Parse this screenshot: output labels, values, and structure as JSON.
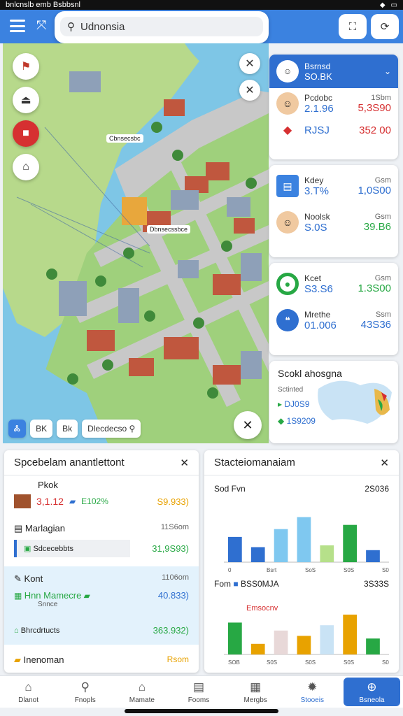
{
  "status": {
    "left": "bnlcnslb emb Bsbbsnl",
    "right_icon": "wifi-icon"
  },
  "search": {
    "value": "Udnonsia"
  },
  "map_controls": {
    "label_a": "Ꮬ",
    "label_b": "BK",
    "label_c": "Bk",
    "search_label": "Dlecdecso",
    "place_label": "Cbnsecsbc",
    "place_label2": "Dbnsecssbce"
  },
  "cards": {
    "card1": {
      "head_name": "Bsrnsd",
      "head_value": "SO.BK",
      "r1": {
        "label": "Pcdobc",
        "value": "2.1.96",
        "right_label": "1Sbm",
        "right_value": "5,3S90"
      },
      "r2": {
        "value": "RJSJ",
        "right_value": "352 00"
      }
    },
    "card2": {
      "r1": {
        "label": "Kdey",
        "value": "3.T%",
        "right_label": "Gsm",
        "right_value": "1,0S00"
      },
      "r2": {
        "label": "Noolsk",
        "value": "S.0S",
        "right_label": "Gsm",
        "right_value": "39.B6"
      }
    },
    "card3": {
      "r1": {
        "label": "Kcet",
        "value": "S3.S6",
        "right_label": "Gsm",
        "right_value": "1.3S00"
      },
      "r2": {
        "label": "Mrethe",
        "value": "01.006",
        "right_label": "Ssm",
        "right_value": "43S36"
      }
    },
    "card4": {
      "title": "Scokl ahosgna",
      "sub": "Sctinted",
      "v1": "DJ0S9",
      "v2": "1S9209"
    }
  },
  "panel_left": {
    "title": "Spcebelam anantlettont",
    "r1": {
      "label": "Pkok",
      "value": "3,1.12",
      "mid": "E102%",
      "right_value": "S9.933)"
    },
    "r2": {
      "label": "Marlagian",
      "right_label": "11S6om",
      "sub": "Sdcecebbts",
      "right_value": "31,9S93)"
    },
    "r3": {
      "label": "Kont",
      "right_label": "1106om",
      "title2": "Hnn Mamecre",
      "sub": "Snnce",
      "right_value": "40.833)"
    },
    "r4": {
      "sub": "Bhrcdrtucts",
      "right_value": "363.932)"
    },
    "r5": {
      "label": "Inenoman",
      "right_label": "Rsom"
    }
  },
  "panel_right": {
    "title": "Stacteiomanaiam",
    "chart1": {
      "label": "Sod Fvn",
      "total": "2S036",
      "ticks": [
        "0",
        "Bsrt",
        "SoS",
        "S0S",
        "S0S"
      ]
    },
    "chart2": {
      "label": "Fom",
      "legend": "BSS0MJA",
      "total": "3S33S",
      "sub": "Emsocnv",
      "ticks": [
        "S0",
        "S0",
        "S0",
        "0",
        "0"
      ],
      "xticks": [
        "SOB",
        "S0S",
        "S0S",
        "S0S",
        "S0S"
      ]
    }
  },
  "chart_data": [
    {
      "type": "bar",
      "title": "Sod Fvn",
      "xlabel": "",
      "ylabel": "",
      "categories": [
        "Bsrt",
        "SoS",
        "S0S",
        "S0S",
        "S0S"
      ],
      "series": [
        {
          "values": [
            42,
            25,
            55,
            75,
            28,
            62,
            20
          ]
        }
      ],
      "ylim": [
        0,
        100
      ]
    },
    {
      "type": "bar",
      "title": "Fom",
      "xlabel": "",
      "ylabel": "",
      "categories": [
        "SOB",
        "S0S",
        "S0S",
        "S0S",
        "S0S"
      ],
      "series": [
        {
          "values": [
            60,
            20,
            45,
            35,
            55,
            75,
            30
          ]
        }
      ],
      "ylim": [
        0,
        100
      ]
    }
  ],
  "nav": {
    "items": [
      {
        "label": "Dlanot",
        "icon": "home-icon"
      },
      {
        "label": "Fnopls",
        "icon": "search-icon"
      },
      {
        "label": "Mamate",
        "icon": "house-icon"
      },
      {
        "label": "Fooms",
        "icon": "document-icon"
      },
      {
        "label": "Mergbs",
        "icon": "grid-icon"
      },
      {
        "label": "Stooeis",
        "icon": "star-icon"
      },
      {
        "label": "Bsneola",
        "icon": "plus-icon"
      }
    ]
  },
  "colors": {
    "primary": "#2f6fd0",
    "topbar": "#3b82e0",
    "water": "#7ec6e6",
    "land": "#b7d98b"
  }
}
